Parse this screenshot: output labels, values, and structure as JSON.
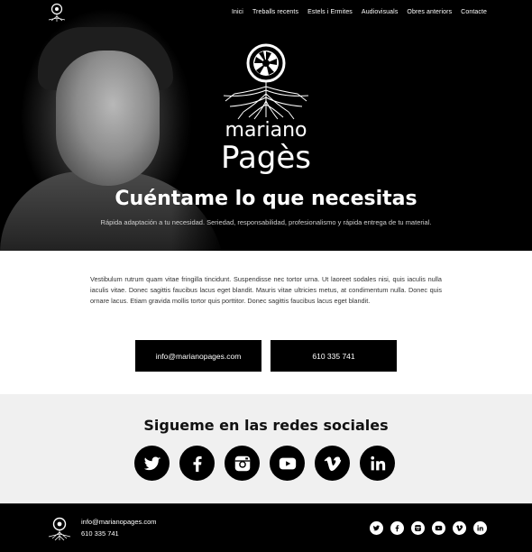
{
  "nav": {
    "items": [
      {
        "label": "Inici"
      },
      {
        "label": "Treballs recents"
      },
      {
        "label": "Estels i Ermites"
      },
      {
        "label": "Audiovisuals"
      },
      {
        "label": "Obres anteriors"
      },
      {
        "label": "Contacte"
      }
    ]
  },
  "brand": {
    "line1": "mariano",
    "line2": "Pagès"
  },
  "hero": {
    "title": "Cuéntame lo que necesitas",
    "subtitle": "Rápida adaptación a tu necesidad. Seriedad, responsabilidad, profesionalismo y rápida entrega de tu material."
  },
  "intro": {
    "text": "Vestibulum rutrum quam vitae fringilla tincidunt. Suspendisse nec tortor urna. Ut laoreet sodales nisi, quis iaculis nulla iaculis vitae. Donec sagittis faucibus lacus eget blandit. Mauris vitae ultricies metus, at condimentum nulla. Donec quis ornare lacus. Etiam gravida mollis tortor quis porttitor. Donec sagittis faucibus lacus eget blandit."
  },
  "contact": {
    "email": "info@marianopages.com",
    "phone": "610 335 741"
  },
  "social": {
    "title": "Sigueme en las redes sociales",
    "networks": [
      "twitter-icon",
      "facebook-icon",
      "instagram-icon",
      "youtube-icon",
      "vimeo-icon",
      "linkedin-icon"
    ]
  },
  "footer": {
    "email": "info@marianopages.com",
    "phone": "610 335 741"
  },
  "colors": {
    "background": "#000000",
    "social_band": "#f0f0f0",
    "text_light": "#ffffff"
  }
}
